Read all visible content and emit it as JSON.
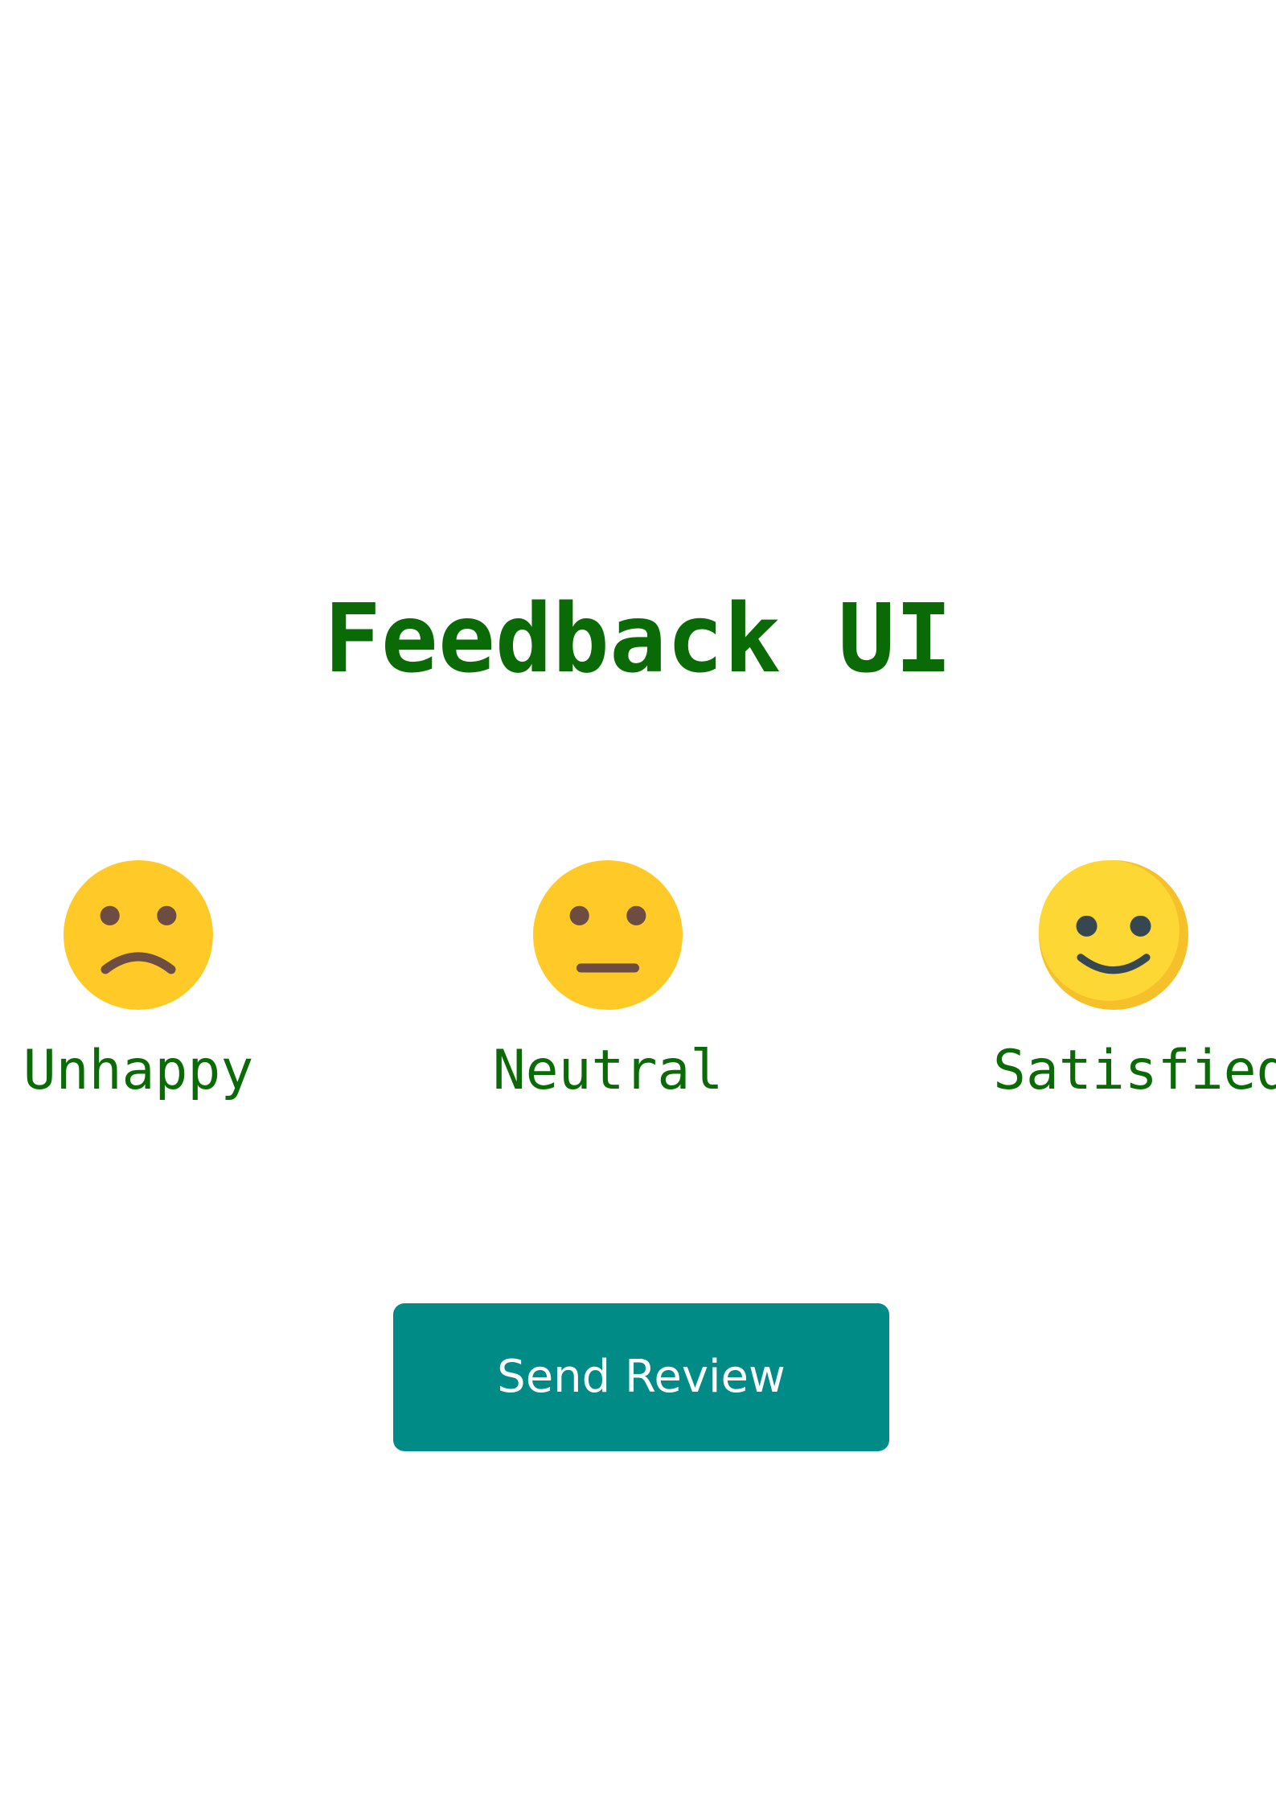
{
  "page": {
    "title": "Feedback UI"
  },
  "ratings": [
    {
      "label": "Unhappy",
      "icon": "sad-face-icon"
    },
    {
      "label": "Neutral",
      "icon": "neutral-face-icon"
    },
    {
      "label": "Satisfied",
      "icon": "smiling-face-icon"
    }
  ],
  "actions": {
    "send_label": "Send Review"
  },
  "colors": {
    "text_accent": "#0a6b06",
    "button_background": "#008b87",
    "button_text": "#ffffff",
    "face_yellow": "#ffca28",
    "face_features": "#6d4c41"
  }
}
